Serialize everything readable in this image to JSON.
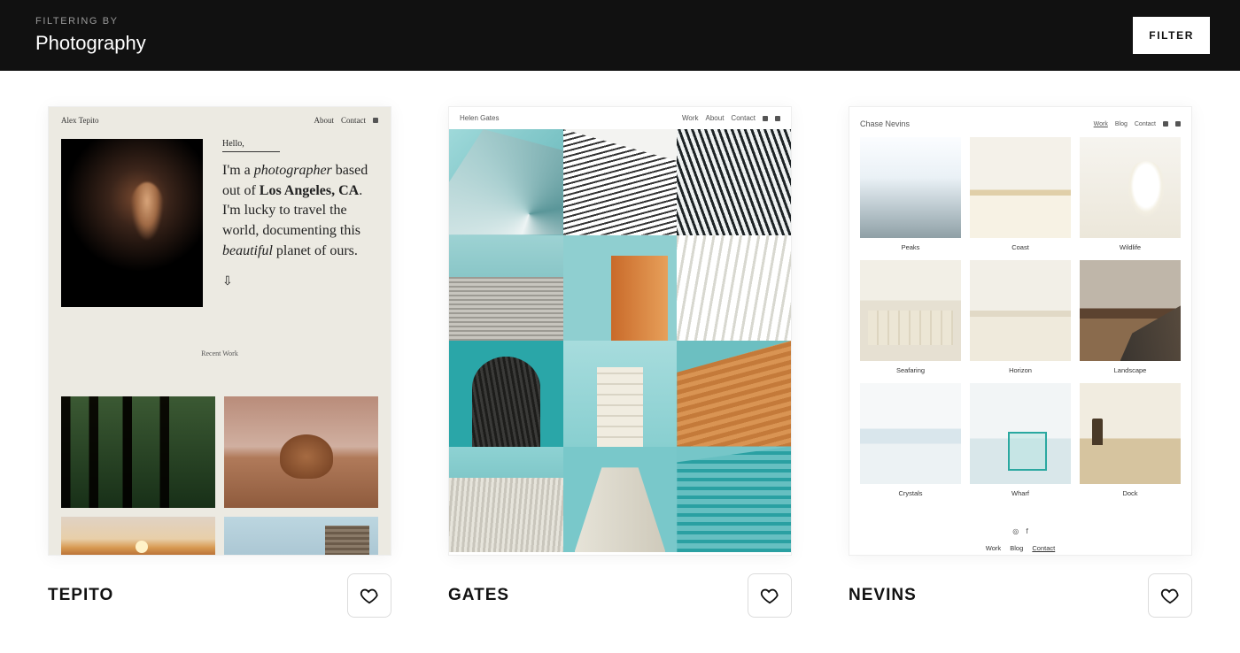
{
  "filterBar": {
    "label": "FILTERING BY",
    "value": "Photography",
    "buttonLabel": "FILTER"
  },
  "templates": [
    {
      "id": "tepito",
      "title": "TEPITO",
      "preview": {
        "brand": "Alex Tepito",
        "navItems": [
          "About",
          "Contact"
        ],
        "hello": "Hello,",
        "tagline_html": "I'm a <em>photographer</em> based out of <b>Los Angeles, CA</b>. I'm lucky to travel the world, documenting this <em>beautiful</em> planet of ours.",
        "arrow": "⇩",
        "sectionLabel": "Recent Work"
      }
    },
    {
      "id": "gates",
      "title": "GATES",
      "preview": {
        "brand": "Helen Gates",
        "navItems": [
          "Work",
          "About",
          "Contact"
        ]
      }
    },
    {
      "id": "nevins",
      "title": "NEVINS",
      "preview": {
        "brand": "Chase Nevins",
        "navItems": [
          "Work",
          "Blog",
          "Contact"
        ],
        "gallery": [
          "Peaks",
          "Coast",
          "Wildlife",
          "Seafaring",
          "Horizon",
          "Landscape",
          "Crystals",
          "Wharf",
          "Dock"
        ],
        "footerLinks": [
          "Work",
          "Blog",
          "Contact"
        ]
      }
    }
  ]
}
